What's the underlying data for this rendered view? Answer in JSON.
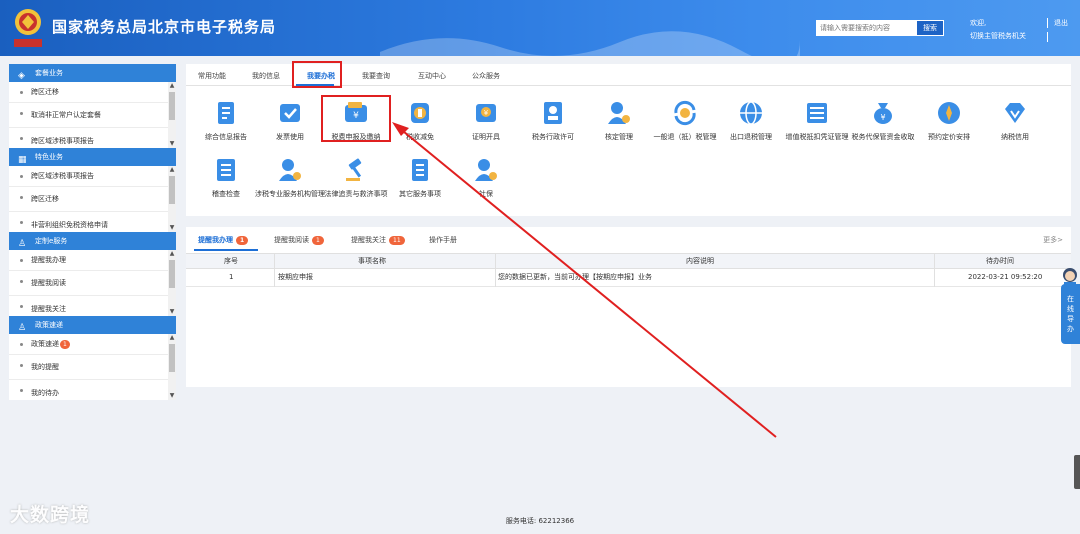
{
  "header": {
    "title": "国家税务总局北京市电子税务局",
    "search": {
      "placeholder": "请输入需要搜索的内容",
      "button": "搜索"
    },
    "welcome": "欢迎,",
    "switch_org": "切换主管税务机关",
    "logout": "退出",
    "emblem_text": "中国税务"
  },
  "sidebar": {
    "panels": [
      {
        "title": "套餐业务",
        "icon": "layers-icon",
        "items": [
          "跨区迁移",
          "取消非正常户认定套餐",
          "跨区域涉税事项报告"
        ]
      },
      {
        "title": "特色业务",
        "icon": "grid-icon",
        "items": [
          "跨区域涉税事项报告",
          "跨区迁移",
          "非营利组织免税资格申请"
        ]
      },
      {
        "title": "定制e服务",
        "icon": "user-icon",
        "items": [
          "提醒我办理",
          "提醒我阅读",
          "提醒我关注"
        ]
      },
      {
        "title": "政策速递",
        "icon": "user-icon",
        "items": [
          "政策速递",
          "我的提醒",
          "我的待办"
        ],
        "badge": "1"
      }
    ]
  },
  "main": {
    "tabs": [
      "常用功能",
      "我的信息",
      "我要办税",
      "我要查询",
      "互动中心",
      "公众服务"
    ],
    "active_tab": "我要办税",
    "functions_row1": [
      {
        "label": "综合信息报告",
        "icon": "report-icon"
      },
      {
        "label": "发票使用",
        "icon": "invoice-icon"
      },
      {
        "label": "税费申报及缴纳",
        "icon": "tax-payment-icon"
      },
      {
        "label": "税收减免",
        "icon": "coin-icon"
      },
      {
        "label": "证明开具",
        "icon": "certificate-icon"
      },
      {
        "label": "税务行政许可",
        "icon": "license-icon"
      },
      {
        "label": "核定管理",
        "icon": "user-gear-icon"
      },
      {
        "label": "一般退（抵）税管理",
        "icon": "refund-icon"
      },
      {
        "label": "出口退税管理",
        "icon": "globe-icon"
      },
      {
        "label": "增值税抵扣凭证管理",
        "icon": "voucher-icon"
      },
      {
        "label": "税务代保管资金收取",
        "icon": "money-bag-icon"
      },
      {
        "label": "预约定价安排",
        "icon": "compass-icon"
      },
      {
        "label": "纳税信用",
        "icon": "diamond-icon"
      }
    ],
    "functions_row2": [
      {
        "label": "稽查检查",
        "icon": "inspection-icon"
      },
      {
        "label": "涉税专业服务机构管理",
        "icon": "agency-icon"
      },
      {
        "label": "法律追责与救济事项",
        "icon": "gavel-icon"
      },
      {
        "label": "其它服务事项",
        "icon": "list-icon"
      },
      {
        "label": "社保",
        "icon": "social-security-icon"
      }
    ]
  },
  "notices": {
    "tabs": [
      {
        "label": "提醒我办理",
        "badge": "1"
      },
      {
        "label": "提醒我阅读",
        "badge": "1"
      },
      {
        "label": "提醒我关注",
        "badge": "11"
      },
      {
        "label": "操作手册",
        "badge": ""
      }
    ],
    "more": "更多>",
    "columns": [
      "序号",
      "事项名称",
      "内容说明",
      "待办时间"
    ],
    "rows": [
      {
        "no": "1",
        "name": "按期应申报",
        "desc": "您的数据已更新，当前可办理【按期应申报】业务",
        "time": "2022-03-21 09:52:20"
      }
    ]
  },
  "footer": {
    "phone": "服务电话: 62212366"
  },
  "float": {
    "online_guide": "在线导办"
  },
  "watermark": "大数跨境",
  "colors": {
    "primary": "#2f82d8",
    "header": "#1a5fbf",
    "highlight": "#e02020",
    "badge": "#f0653b"
  }
}
